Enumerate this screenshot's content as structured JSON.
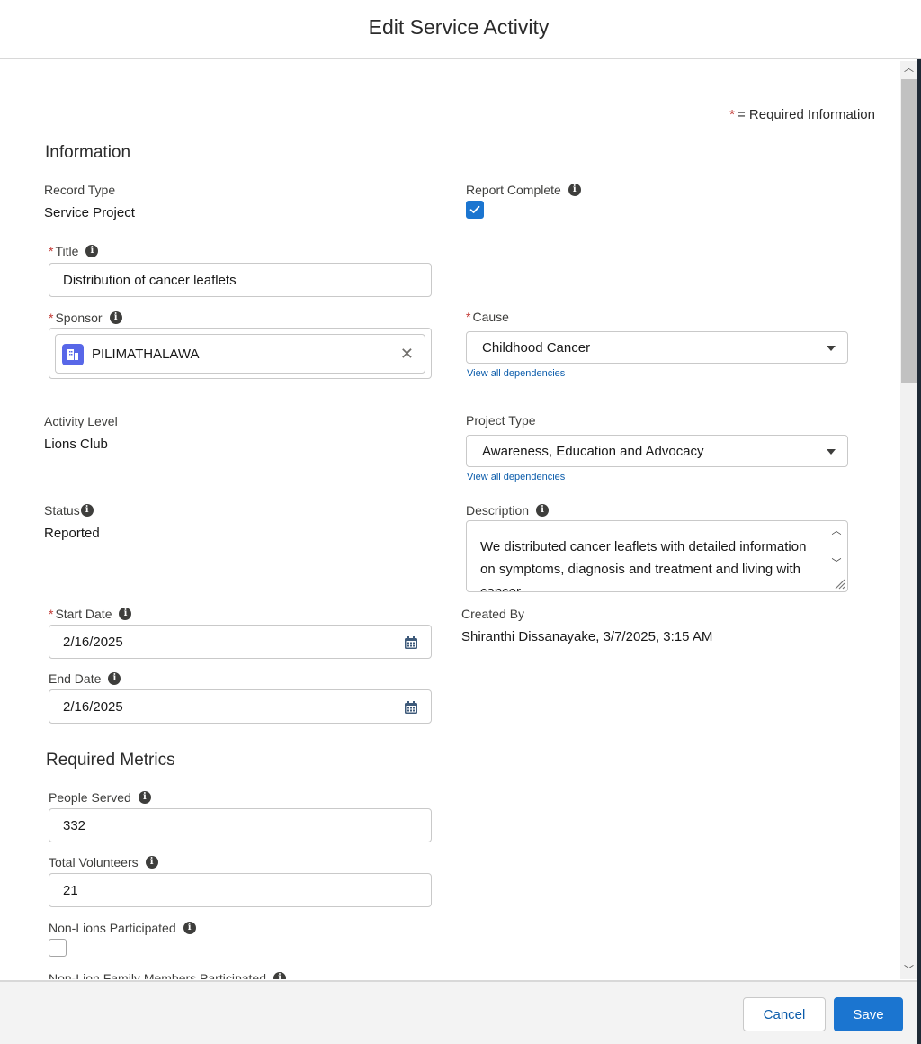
{
  "modal": {
    "title": "Edit Service Activity"
  },
  "required_note": {
    "star": "*",
    "text": "= Required Information"
  },
  "sections": {
    "information": "Information",
    "required_metrics": "Required Metrics"
  },
  "fields": {
    "record_type": {
      "label": "Record Type",
      "value": "Service Project"
    },
    "report_complete": {
      "label": "Report Complete",
      "checked": true
    },
    "title": {
      "label": "Title",
      "value": "Distribution of cancer leaflets",
      "required": true
    },
    "sponsor": {
      "label": "Sponsor",
      "value": "PILIMATHALAWA",
      "required": true,
      "icon": "account-icon"
    },
    "cause": {
      "label": "Cause",
      "value": "Childhood Cancer",
      "link": "View all dependencies",
      "required": true
    },
    "activity_level": {
      "label": "Activity Level",
      "value": "Lions Club"
    },
    "project_type": {
      "label": "Project Type",
      "value": "Awareness, Education and Advocacy",
      "link": "View all dependencies"
    },
    "status": {
      "label": "Status",
      "value": "Reported"
    },
    "description": {
      "label": "Description",
      "value": "We distributed cancer leaflets with detailed information on symptoms, diagnosis and treatment and living with cancer"
    },
    "start_date": {
      "label": "Start Date",
      "value": "2/16/2025",
      "required": true
    },
    "created_by": {
      "label": "Created By",
      "value": "Shiranthi Dissanayake, 3/7/2025, 3:15 AM"
    },
    "end_date": {
      "label": "End Date",
      "value": "2/16/2025"
    },
    "people_served": {
      "label": "People Served",
      "value": "332"
    },
    "total_volunteers": {
      "label": "Total Volunteers",
      "value": "21"
    },
    "non_lions_participated": {
      "label": "Non-Lions Participated",
      "checked": false
    },
    "non_lion_family_members": {
      "label": "Non-Lion Family Members Participated"
    }
  },
  "footer": {
    "cancel_label": "Cancel",
    "save_label": "Save"
  },
  "colors": {
    "brand_blue": "#1b75d0",
    "link_blue": "#0b5cab",
    "required_red": "#c23934",
    "account_icon": "#5867e8"
  }
}
